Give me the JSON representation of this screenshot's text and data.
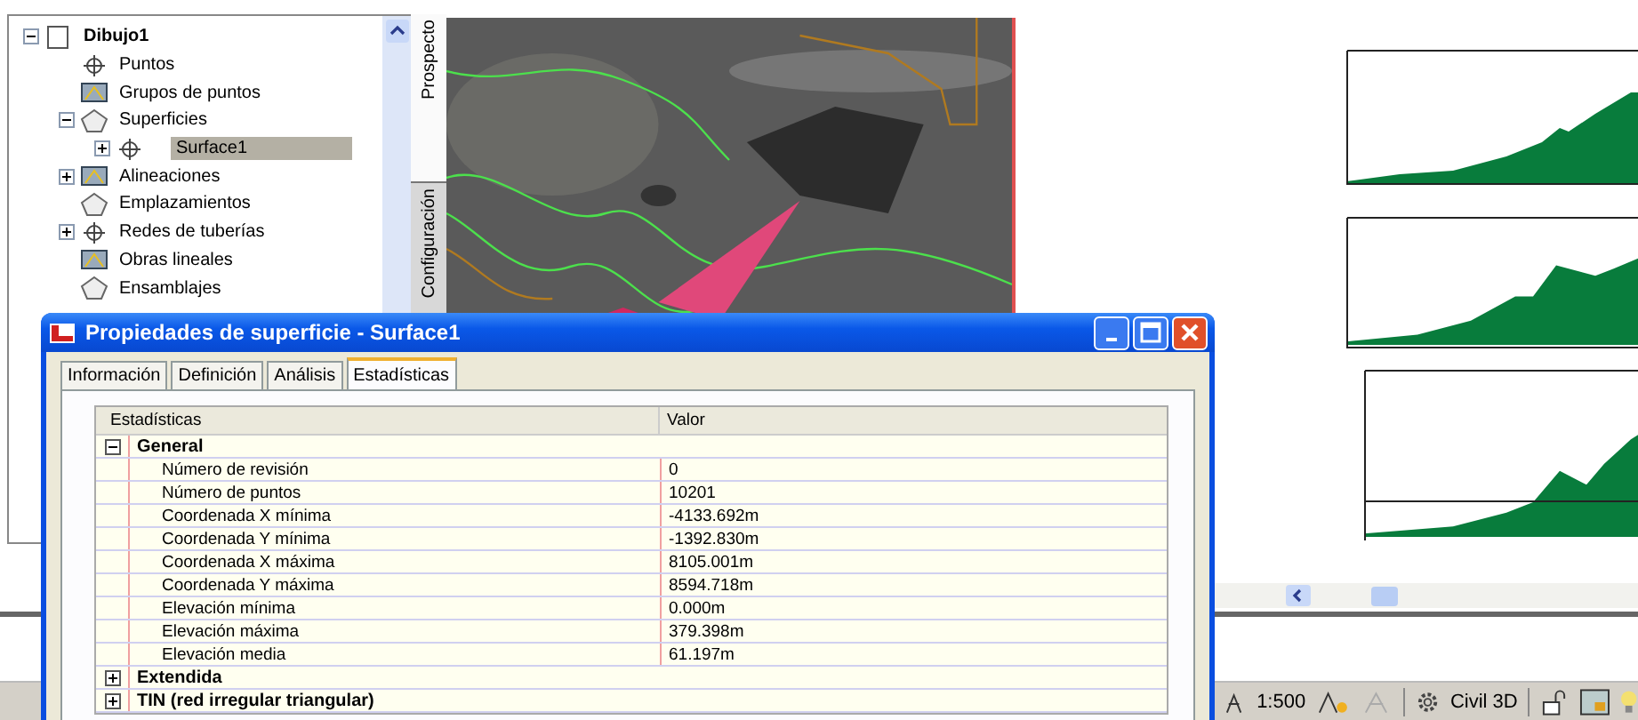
{
  "tree": {
    "label": "Dibujo1",
    "expanded": true,
    "selected": false,
    "children": [
      {
        "label": "Puntos",
        "selected": false
      },
      {
        "label": "Grupos de puntos",
        "selected": false
      },
      {
        "label": "Superficies",
        "expanded": true,
        "selected": false,
        "children": [
          {
            "label": "Surface1",
            "expanded": false,
            "selected": true
          }
        ]
      },
      {
        "label": "Alineaciones",
        "expanded": false,
        "selected": false
      },
      {
        "label": "Emplazamientos",
        "selected": false
      },
      {
        "label": "Redes de tuberías",
        "expanded": false,
        "selected": false
      },
      {
        "label": "Obras lineales",
        "selected": false
      },
      {
        "label": "Ensamblajes",
        "selected": false
      }
    ]
  },
  "side_tabs": [
    {
      "label": "Prospecto",
      "selected": true
    },
    {
      "label": "Configuración",
      "selected": false
    }
  ],
  "status_bar": {
    "scale": "1:500",
    "workspace": "Civil 3D"
  },
  "dialog": {
    "title": "Propiedades de superficie - Surface1",
    "tabs": [
      {
        "label": "Información",
        "selected": false
      },
      {
        "label": "Definición",
        "selected": false
      },
      {
        "label": "Análisis",
        "selected": false
      },
      {
        "label": "Estadísticas",
        "selected": true
      }
    ],
    "columns": [
      "Estadísticas",
      "Valor"
    ],
    "groups": [
      {
        "label": "General",
        "expanded": true,
        "rows": [
          {
            "name": "Número de revisión",
            "value": "0"
          },
          {
            "name": "Número de puntos",
            "value": "10201"
          },
          {
            "name": "Coordenada X mínima",
            "value": "-4133.692m"
          },
          {
            "name": "Coordenada Y mínima",
            "value": "-1392.830m"
          },
          {
            "name": "Coordenada X máxima",
            "value": "8105.001m"
          },
          {
            "name": "Coordenada Y máxima",
            "value": "8594.718m"
          },
          {
            "name": "Elevación mínima",
            "value": "0.000m"
          },
          {
            "name": "Elevación máxima",
            "value": "379.398m"
          },
          {
            "name": "Elevación media",
            "value": "61.197m"
          }
        ]
      },
      {
        "label": "Extendida",
        "expanded": false
      },
      {
        "label": "TIN (red irregular triangular)",
        "expanded": false
      }
    ]
  }
}
